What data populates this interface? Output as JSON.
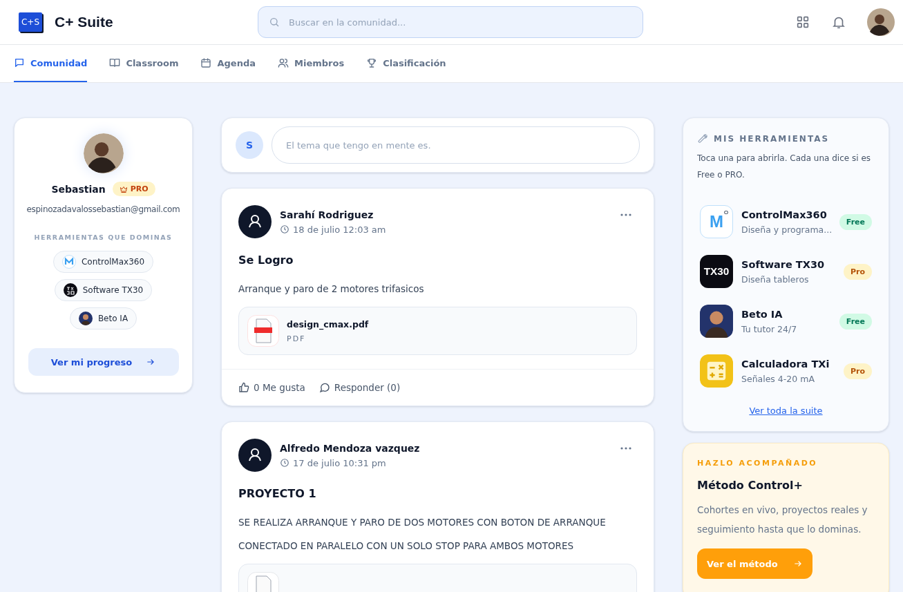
{
  "app": {
    "logo_text": "C+S",
    "name": "C+ Suite"
  },
  "search": {
    "placeholder": "Buscar en la comunidad..."
  },
  "tabs": [
    {
      "label": "Comunidad",
      "selected": true
    },
    {
      "label": "Classroom",
      "selected": false
    },
    {
      "label": "Agenda",
      "selected": false
    },
    {
      "label": "Miembros",
      "selected": false
    },
    {
      "label": "Clasificación",
      "selected": false
    }
  ],
  "profile": {
    "name": "Sebastian",
    "badge": "PRO",
    "email": "espinozadavalossebastian@gmail.com",
    "tools_heading": "HERRAMIENTAS QUE DOMINAS",
    "tools": [
      {
        "name": "ControlMax360",
        "kind": "cmax"
      },
      {
        "name": "Software TX30",
        "kind": "tx30"
      },
      {
        "name": "Beto IA",
        "kind": "beto"
      }
    ],
    "button": "Ver mi progreso"
  },
  "composer": {
    "initial": "S",
    "placeholder": "El tema que tengo en mente es."
  },
  "posts": [
    {
      "author": "Sarahí Rodriguez",
      "time": "18 de julio 12:03 am",
      "title": "Se Logro",
      "body": [
        "Arranque y paro de 2 motores trifasicos"
      ],
      "attachment": {
        "kind": "pdf",
        "name": "design_cmax.pdf",
        "type": "PDF"
      },
      "likes": "0 Me gusta",
      "replies": "Responder (0)"
    },
    {
      "author": "Alfredo Mendoza vazquez",
      "time": "17 de julio 10:31 pm",
      "title": "PROYECTO 1",
      "body": [
        "SE REALIZA ARRANQUE Y PARO DE DOS MOTORES CON BOTON DE ARRANQUE",
        "CONECTADO EN PARALELO CON UN SOLO STOP PARA AMBOS MOTORES"
      ],
      "attachment": {
        "kind": "file"
      }
    }
  ],
  "my_tools": {
    "heading": "MIS HERRAMIENTAS",
    "intro": "Toca una para abrirla. Cada una dice si es Free o PRO.",
    "items": [
      {
        "name": "ControlMax360",
        "desc": "Diseña y programa...",
        "tier": "Free",
        "kind": "cmax",
        "icon_text": "M"
      },
      {
        "name": "Software TX30",
        "desc": "Diseña tableros",
        "tier": "Pro",
        "kind": "tx30",
        "icon_text": "TX30"
      },
      {
        "name": "Beto IA",
        "desc": "Tu tutor 24/7",
        "tier": "Free",
        "kind": "beto"
      },
      {
        "name": "Calculadora TXi",
        "desc": "Señales 4-20 mA",
        "tier": "Pro",
        "kind": "calc"
      }
    ],
    "link": "Ver toda la suite"
  },
  "promo": {
    "eyebrow": "HAZLO ACOMPAÑADO",
    "title": "Método Control+",
    "text": "Cohortes en vivo, proyectos reales y seguimiento hasta que lo dominas.",
    "button": "Ver el método"
  }
}
